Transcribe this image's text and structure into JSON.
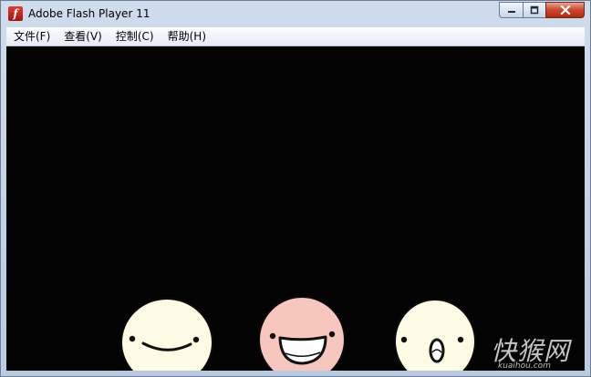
{
  "window": {
    "title": "Adobe Flash Player 11",
    "icon": "flash-player-icon",
    "icon_glyph": "f"
  },
  "controls": {
    "minimize_icon": "minimize-icon",
    "maximize_icon": "maximize-icon",
    "close_icon": "close-icon"
  },
  "menu": {
    "items": [
      {
        "label": "文件(F)"
      },
      {
        "label": "查看(V)"
      },
      {
        "label": "控制(C)"
      },
      {
        "label": "帮助(H)"
      }
    ]
  },
  "stage": {
    "background": "#030303",
    "characters": [
      {
        "name": "smiling-face",
        "color": "#fdfbe3"
      },
      {
        "name": "pink-face",
        "color": "#f7c6bd"
      },
      {
        "name": "surprised-face",
        "color": "#fdfbe3"
      }
    ]
  },
  "watermark": {
    "text": "快猴网",
    "domain": "kuaihou.com"
  },
  "colors": {
    "titlebar": "#cfdcec",
    "close_button": "#c9462a"
  }
}
